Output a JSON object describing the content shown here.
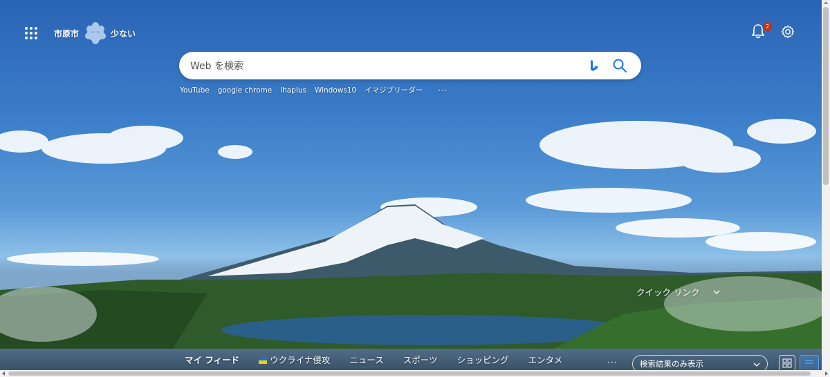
{
  "header": {
    "location": "市原市",
    "weather_text": "少ない",
    "weather_icon": "cloud-face-icon",
    "notification_count": "2"
  },
  "search": {
    "placeholder": "Web を検索"
  },
  "quick_links": [
    "YouTube",
    "google chrome",
    "lhaplus",
    "Windows10",
    "イマジブリーダー"
  ],
  "quick_links_more": "···",
  "quick_link_toggle": "クイック リンク",
  "feed": {
    "tabs": [
      "マイ フィード",
      "ウクライナ侵攻",
      "ニュース",
      "スポーツ",
      "ショッピング",
      "エンタメ"
    ],
    "more": "···",
    "filter_selected": "検索結果のみ表示"
  },
  "colors": {
    "accent": "#4aa3ff",
    "badge": "#c4311c",
    "bing_blue": "#1a73e8"
  }
}
